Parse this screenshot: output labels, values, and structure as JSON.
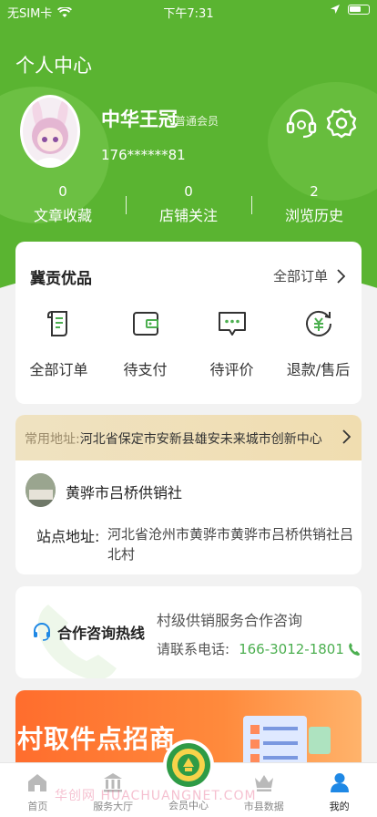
{
  "status_bar": {
    "carrier": "无SIM卡",
    "time": "下午7:31"
  },
  "header": {
    "title": "个人中心"
  },
  "profile": {
    "name": "中华王冠",
    "member_level": "普通会员",
    "phone": "176******81"
  },
  "stats": [
    {
      "count": "0",
      "label": "文章收藏"
    },
    {
      "count": "0",
      "label": "店铺关注"
    },
    {
      "count": "2",
      "label": "浏览历史"
    }
  ],
  "orders": {
    "title": "冀贡优品",
    "all_orders_link": "全部订单",
    "items": [
      {
        "label": "全部订单",
        "icon": "order-list-icon"
      },
      {
        "label": "待支付",
        "icon": "wallet-icon"
      },
      {
        "label": "待评价",
        "icon": "comment-icon"
      },
      {
        "label": "退款/售后",
        "icon": "refund-icon"
      }
    ]
  },
  "address": {
    "common_label": "常用地址:",
    "common_address": "河北省保定市安新县雄安未来城市创新中心",
    "shop_name": "黄骅市吕桥供销社",
    "site_label": "站点地址:",
    "site_address": "河北省沧州市黄骅市黄骅市吕桥供销社吕北村"
  },
  "hotline": {
    "title": "合作咨询热线",
    "description": "村级供销服务合作咨询",
    "phone_prefix": "请联系电话:",
    "phone": "166-3012-1801"
  },
  "banner": {
    "title": "村取件点招商"
  },
  "tabbar": [
    {
      "label": "首页",
      "icon": "home-icon"
    },
    {
      "label": "服务大厅",
      "icon": "service-hall-icon"
    },
    {
      "label": "会员中心",
      "icon": "member-center-emblem-icon"
    },
    {
      "label": "市县数据",
      "icon": "crown-icon"
    },
    {
      "label": "我的",
      "icon": "user-icon"
    }
  ],
  "watermark": "华创网 HUACHUANGNET.COM",
  "colors": {
    "primary_green": "#5ab431",
    "accent_blue": "#1e88e5",
    "phone_green": "#4caf50",
    "banner_orange": "#ff6d2d"
  }
}
